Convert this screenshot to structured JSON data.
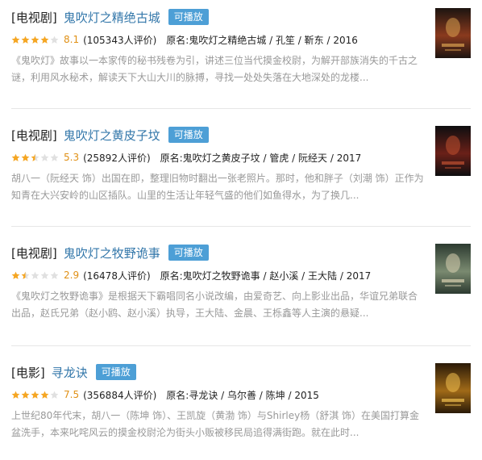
{
  "items": [
    {
      "category": "[电视剧]",
      "title": "鬼吹灯之精绝古城",
      "badge": "可播放",
      "rating_stars": 4,
      "score": "8.1",
      "count": "(105343人评价)",
      "info": "原名:鬼吹灯之精绝古城 / 孔笙 / 靳东 / 2016",
      "desc": "《鬼吹灯》故事以一本家传的秘书残卷为引，讲述三位当代摸金校尉，为解开部族消失的千古之谜，利用风水秘术，解读天下大山大川的脉搏，寻找一处处失落在大地深处的龙楼...",
      "poster_icon": "poster-jingjue",
      "poster_colors": [
        "#1c1410",
        "#8a3a1e",
        "#d9a050"
      ]
    },
    {
      "category": "[电视剧]",
      "title": "鬼吹灯之黄皮子坟",
      "badge": "可播放",
      "rating_stars": 2.5,
      "score": "5.3",
      "count": "(25892人评价)",
      "info": "原名:鬼吹灯之黄皮子坟 / 管虎 / 阮经天 / 2017",
      "desc": "胡八一（阮经天 饰）出国在即，整理旧物时翻出一张老照片。那时，他和胖子（刘潮 饰）正作为知青在大兴安岭的山区插队。山里的生活让年轻气盛的他们如鱼得水，为了换几...",
      "poster_icon": "poster-huangpizi",
      "poster_colors": [
        "#0e0e10",
        "#6a2018",
        "#c05030"
      ]
    },
    {
      "category": "[电视剧]",
      "title": "鬼吹灯之牧野诡事",
      "badge": "可播放",
      "rating_stars": 1.5,
      "score": "2.9",
      "count": "(16478人评价)",
      "info": "原名:鬼吹灯之牧野诡事 / 赵小溪 / 王大陆 / 2017",
      "desc": "《鬼吹灯之牧野诡事》是根据天下霸唱同名小说改编，由爱奇艺、向上影业出品，华谊兄弟联合出品，赵氏兄弟（赵小鸥、赵小溪）执导，王大陆、金晨、王栎鑫等人主演的悬疑...",
      "poster_icon": "poster-muye",
      "poster_colors": [
        "#2c3a30",
        "#7a8a70",
        "#d8d0b0"
      ]
    },
    {
      "category": "[电影]",
      "title": "寻龙诀",
      "badge": "可播放",
      "rating_stars": 4,
      "score": "7.5",
      "count": "(356884人评价)",
      "info": "原名:寻龙诀 / 乌尔善 / 陈坤 / 2015",
      "desc": "上世纪80年代末，胡八一（陈坤 饰）、王凯旋（黄渤 饰）与Shirley杨（舒淇 饰）在美国打算金盆洗手，本来叱咤风云的摸金校尉沦为街头小贩被移民局追得满街跑。就在此时...",
      "poster_icon": "poster-xunlong",
      "poster_colors": [
        "#2a1a08",
        "#a06a18",
        "#f0c050"
      ]
    }
  ],
  "colors": {
    "title_link": "#3377aa",
    "badge_bg": "#4d9fd6",
    "score": "#e09015",
    "star_full": "#f5a623",
    "star_empty": "#e0e0e0",
    "desc": "#999999"
  }
}
